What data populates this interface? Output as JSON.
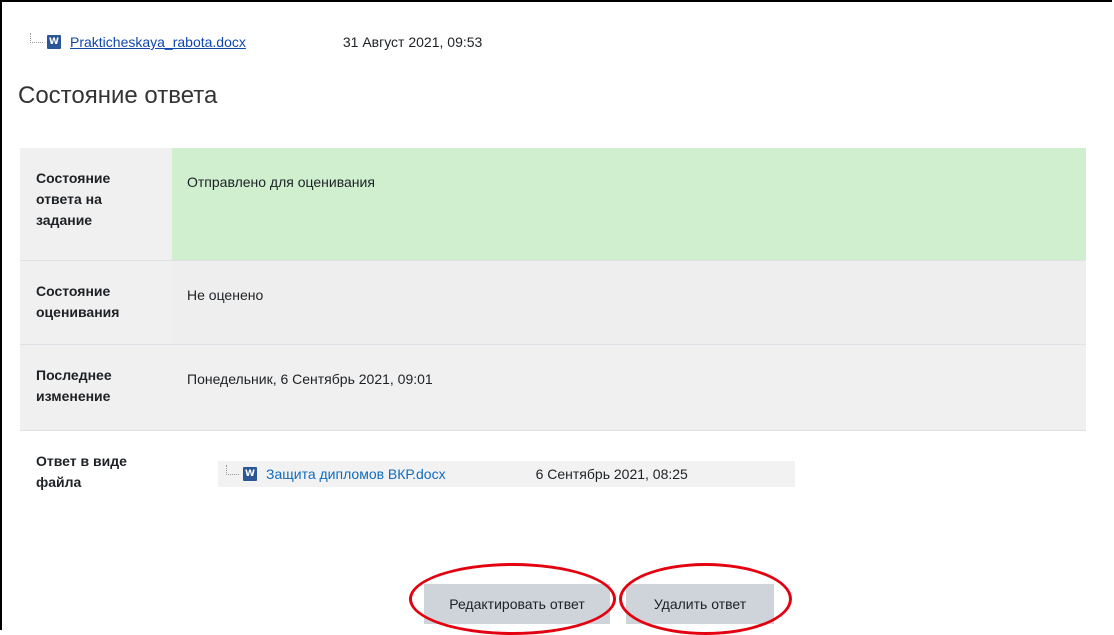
{
  "top_file": {
    "name": "Prakticheskaya_rabota.docx",
    "date": "31 Август 2021, 09:53",
    "icon": "W"
  },
  "section_title": "Состояние ответа",
  "status_table": [
    {
      "label": "Состояние ответа на задание",
      "value": "Отправлено для оценивания"
    },
    {
      "label": "Состояние оценивания",
      "value": "Не оценено"
    },
    {
      "label": "Последнее изменение",
      "value": "Понедельник, 6 Сентябрь 2021, 09:01"
    },
    {
      "label": "Ответ в виде файла",
      "value": ""
    }
  ],
  "submission_file": {
    "name": "Защита дипломов ВКР.docx",
    "date": "6 Сентябрь 2021, 08:25",
    "icon": "W"
  },
  "buttons": {
    "edit": "Редактировать ответ",
    "remove": "Удалить ответ"
  },
  "colors": {
    "submitted_green": "#cfefcf",
    "link_blue": "#0f6cbf",
    "highlight_red": "#e3000f",
    "word_blue": "#2b5797"
  }
}
